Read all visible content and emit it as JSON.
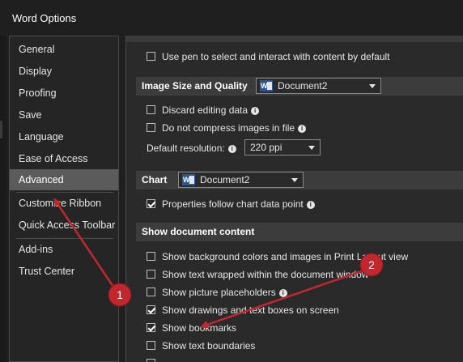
{
  "window": {
    "title": "Word Options"
  },
  "nav": {
    "items": [
      "General",
      "Display",
      "Proofing",
      "Save",
      "Language",
      "Ease of Access",
      "Advanced",
      "Customize Ribbon",
      "Quick Access Toolbar",
      "Add-ins",
      "Trust Center"
    ],
    "active": "Advanced"
  },
  "content": {
    "pen_row": {
      "label": "Use pen to select and interact with content by default",
      "checked": false
    },
    "image_size": {
      "header": "Image Size and Quality",
      "document": "Document2",
      "discard": {
        "label": "Discard editing data",
        "checked": false
      },
      "no_compress": {
        "label": "Do not compress images in file",
        "checked": false
      },
      "resolution_label": "Default resolution:",
      "resolution_value": "220 ppi"
    },
    "chart": {
      "header": "Chart",
      "document": "Document2",
      "properties": {
        "label": "Properties follow chart data point",
        "checked": true
      }
    },
    "show_doc": {
      "header": "Show document content",
      "items": [
        {
          "label": "Show background colors and images in Print Layout view",
          "checked": false
        },
        {
          "label": "Show text wrapped within the document window",
          "checked": false
        },
        {
          "label": "Show picture placeholders",
          "checked": false
        },
        {
          "label": "Show drawings and text boxes on screen",
          "checked": true
        },
        {
          "label": "Show bookmarks",
          "checked": true
        },
        {
          "label": "Show text boundaries",
          "checked": false
        }
      ]
    }
  },
  "annotations": {
    "badge1": "1",
    "badge2": "2",
    "color": "#c0282d"
  }
}
